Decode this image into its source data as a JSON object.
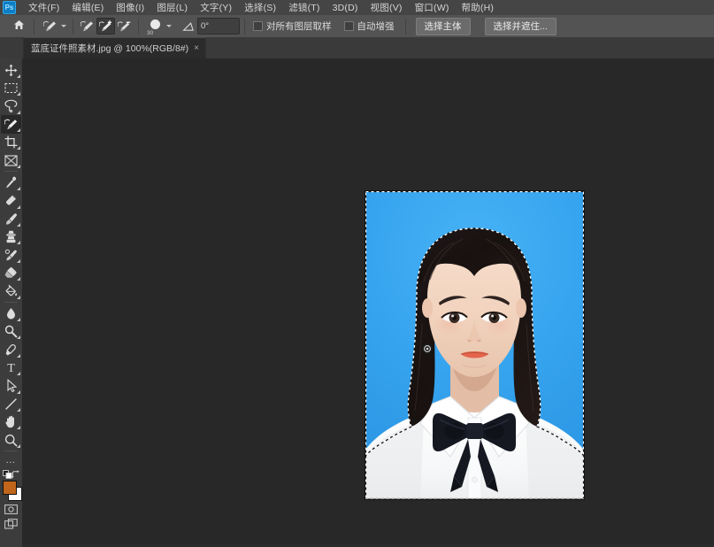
{
  "app": {
    "name": "Adobe Photoshop",
    "logo_text": "Ps"
  },
  "menubar": {
    "items": [
      {
        "label": "文件(F)",
        "name": "menu-file"
      },
      {
        "label": "编辑(E)",
        "name": "menu-edit"
      },
      {
        "label": "图像(I)",
        "name": "menu-image"
      },
      {
        "label": "图层(L)",
        "name": "menu-layer"
      },
      {
        "label": "文字(Y)",
        "name": "menu-type"
      },
      {
        "label": "选择(S)",
        "name": "menu-select"
      },
      {
        "label": "滤镜(T)",
        "name": "menu-filter"
      },
      {
        "label": "3D(D)",
        "name": "menu-3d"
      },
      {
        "label": "视图(V)",
        "name": "menu-view"
      },
      {
        "label": "窗口(W)",
        "name": "menu-window"
      },
      {
        "label": "帮助(H)",
        "name": "menu-help"
      }
    ]
  },
  "options_bar": {
    "home_icon": "home-icon",
    "tool_preset_icon": "quick-selection-tool-icon",
    "tool_preset_caret": "chevron-down-icon",
    "selection_modes": [
      {
        "name": "selection-mode-new",
        "icon": "quick-selection-new-icon",
        "active": false
      },
      {
        "name": "selection-mode-add",
        "icon": "quick-selection-add-icon",
        "active": true
      },
      {
        "name": "selection-mode-subtract",
        "icon": "quick-selection-subtract-icon",
        "active": false
      }
    ],
    "brush_size": "30",
    "brush_caret": "chevron-down-icon",
    "angle_icon": "angle-icon",
    "angle_value": "0°",
    "sample_all_layers": {
      "label": "对所有图层取样",
      "checked": false
    },
    "auto_enhance": {
      "label": "自动增强",
      "checked": false
    },
    "select_subject_button": "选择主体",
    "select_and_mask_button": "选择并遮住..."
  },
  "tabs": [
    {
      "title": "蓝底证件照素材.jpg @ 100%(RGB/8#)",
      "close": "×",
      "active": true
    }
  ],
  "toolbar": {
    "tools": [
      {
        "name": "move-tool",
        "icon": "move-icon",
        "active": false
      },
      {
        "name": "rectangular-marquee-tool",
        "icon": "marquee-icon",
        "active": false
      },
      {
        "name": "lasso-tool",
        "icon": "lasso-icon",
        "active": false
      },
      {
        "name": "quick-selection-tool",
        "icon": "quick-selection-icon",
        "active": true
      },
      {
        "name": "crop-tool",
        "icon": "crop-icon",
        "active": false
      },
      {
        "name": "frame-tool",
        "icon": "frame-icon",
        "active": false
      },
      {
        "name": "eyedropper-tool",
        "icon": "eyedropper-icon",
        "active": false
      },
      {
        "name": "healing-brush-tool",
        "icon": "healing-brush-icon",
        "active": false
      },
      {
        "name": "brush-tool",
        "icon": "brush-icon",
        "active": false
      },
      {
        "name": "clone-stamp-tool",
        "icon": "clone-stamp-icon",
        "active": false
      },
      {
        "name": "history-brush-tool",
        "icon": "history-brush-icon",
        "active": false
      },
      {
        "name": "eraser-tool",
        "icon": "eraser-icon",
        "active": false
      },
      {
        "name": "gradient-tool",
        "icon": "paint-bucket-icon",
        "active": false
      },
      {
        "name": "blur-tool",
        "icon": "blur-drop-icon",
        "active": false
      },
      {
        "name": "dodge-tool",
        "icon": "dodge-icon",
        "active": false
      },
      {
        "name": "pen-tool",
        "icon": "pen-icon",
        "active": false
      },
      {
        "name": "type-tool",
        "icon": "type-t-icon",
        "active": false
      },
      {
        "name": "path-selection-tool",
        "icon": "path-arrow-icon",
        "active": false
      },
      {
        "name": "line-tool",
        "icon": "line-icon",
        "active": false
      },
      {
        "name": "hand-tool",
        "icon": "hand-icon",
        "active": false
      },
      {
        "name": "zoom-tool",
        "icon": "magnifier-icon",
        "active": false
      }
    ],
    "more_tools": "…",
    "colors": {
      "foreground": "#c0651a",
      "background": "#ffffff",
      "swap_icon": "swap-colors-icon",
      "default_icon": "default-colors-icon"
    },
    "quick_mask_icon": "quick-mask-icon",
    "screen_mode_icon": "screen-mode-icon"
  },
  "canvas": {
    "background_color": "#282828",
    "document": {
      "name": "id-photo",
      "zoom": "100%",
      "color_mode": "RGB/8#",
      "photo_background_color": "#38a8f0",
      "selection_active": true,
      "selection_description": "marching-ants selection around subject"
    }
  }
}
